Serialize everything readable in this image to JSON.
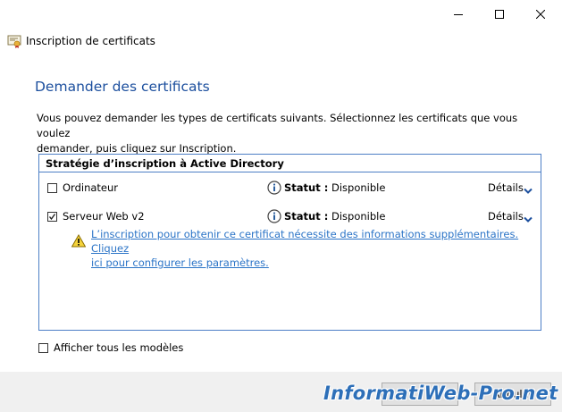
{
  "window": {
    "title": "Inscription de certificats",
    "controls": [
      "minimize-icon",
      "maximize-icon",
      "close-icon"
    ]
  },
  "page": {
    "heading": "Demander des certificats",
    "intro_line1": "Vous pouvez demander les types de certificats suivants. Sélectionnez les certificats que vous voulez",
    "intro_line2": "demander, puis cliquez sur Inscription."
  },
  "policy": {
    "header": "Stratégie d’inscription à Active Directory",
    "items": [
      {
        "label": "Ordinateur",
        "checked": false,
        "status_label": "Statut :",
        "status_value": "Disponible",
        "details_label": "Détails"
      },
      {
        "label": "Serveur Web v2",
        "checked": true,
        "status_label": "Statut :",
        "status_value": "Disponible",
        "details_label": "Détails",
        "warning_line1": "L’inscription pour obtenir ce certificat nécessite des informations supplémentaires. Cliquez",
        "warning_line2": "ici pour configurer les paramètres."
      }
    ]
  },
  "options": {
    "show_all_label": "Afficher tous les modèles",
    "show_all_checked": false
  },
  "footer": {
    "cancel_label": "Annuler",
    "watermark": "InformatiWeb-Pro.net"
  },
  "colors": {
    "heading": "#1c4f9e",
    "link": "#2b74c7",
    "group_border": "#4d7fc6",
    "chevron": "#1c4f9e"
  }
}
